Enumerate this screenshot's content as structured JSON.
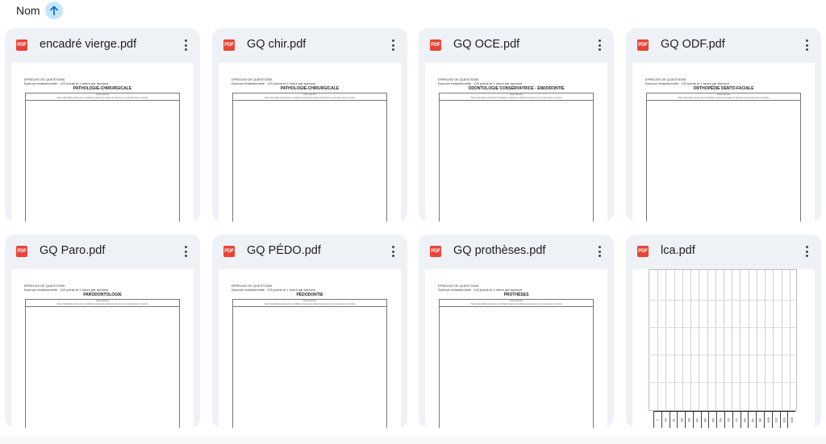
{
  "sort": {
    "label": "Nom",
    "icon": "arrow-upward-icon"
  },
  "doc_header": {
    "line1": "EPREUVE DE QUESTIONS",
    "line2": "Epreuve rédactionnelle : 120 points et 1 heure par épreuve",
    "box_label": "Copie blanche",
    "box_note": "Toute information portée par le candidat et relevée ou copiée de réponse ne sera pas prise en compte"
  },
  "files": [
    {
      "name": "encadré vierge.pdf",
      "subject": "PATHOLOGIE-CHIRURGICALE",
      "icon": "pdf-icon",
      "preview": "document"
    },
    {
      "name": "GQ chir.pdf",
      "subject": "PATHOLOGIE-CHIRURGICALE",
      "icon": "pdf-icon",
      "preview": "document"
    },
    {
      "name": "GQ OCE.pdf",
      "subject": "ODONTOLOGIE CONSERVATRICE - ENDODONTIE",
      "icon": "pdf-icon",
      "preview": "document"
    },
    {
      "name": "GQ ODF.pdf",
      "subject": "ORTHOPÉDIE DENTO-FACIALE",
      "icon": "pdf-icon",
      "preview": "document"
    },
    {
      "name": "GQ Paro.pdf",
      "subject": "PARODONTOLOGIE",
      "icon": "pdf-icon",
      "preview": "document"
    },
    {
      "name": "GQ PÉDO.pdf",
      "subject": "PÉDODONTIE",
      "icon": "pdf-icon",
      "preview": "document"
    },
    {
      "name": "GQ prothèses.pdf",
      "subject": "PROTHÈSES",
      "icon": "pdf-icon",
      "preview": "document"
    },
    {
      "name": "lca.pdf",
      "subject": "",
      "icon": "pdf-icon",
      "preview": "grid",
      "grid_labels": [
        "7",
        "14",
        "21",
        "28",
        "35",
        "42",
        "49",
        "56",
        "63",
        "70",
        "77",
        "84",
        "91",
        "98",
        "105",
        "112",
        "119",
        "126"
      ]
    }
  ],
  "pdf_badge": "PDF",
  "colors": {
    "card_bg": "#eef1f6",
    "sort_accent": "#c2e7ff",
    "pdf_red": "#ea4335"
  }
}
